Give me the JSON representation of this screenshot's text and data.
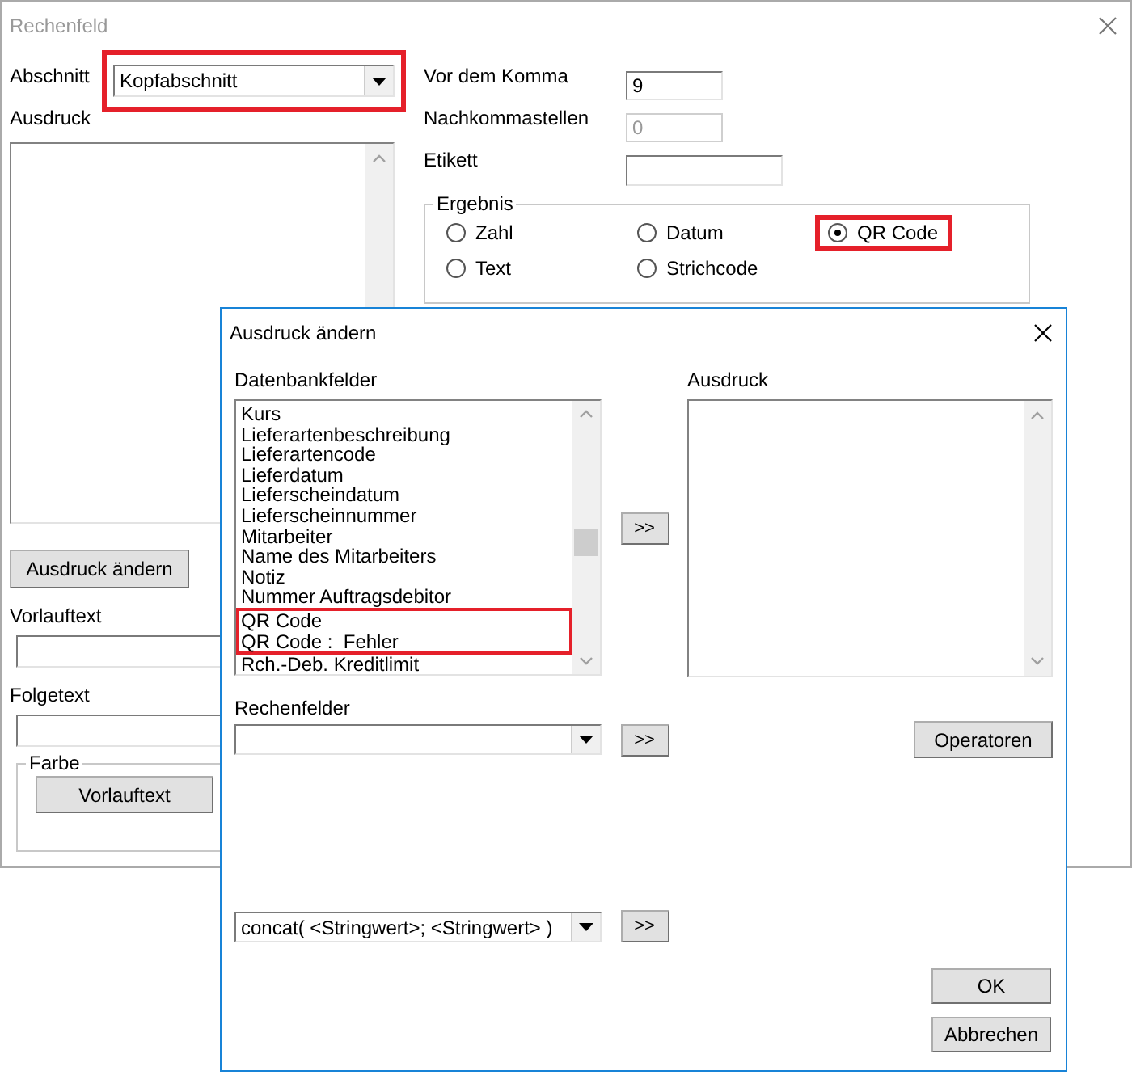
{
  "main_window": {
    "title": "Rechenfeld",
    "active": false,
    "section": {
      "label": "Abschnitt",
      "value": "Kopfabschnitt",
      "highlighted": true
    },
    "expression": {
      "label": "Ausdruck"
    },
    "edit_button": "Ausdruck ändern",
    "prefix": {
      "label": "Vorlauftext"
    },
    "suffix": {
      "label": "Folgetext"
    },
    "color_group": {
      "title": "Farbe",
      "button": "Vorlauftext"
    },
    "fields": [
      {
        "label": "Vor dem Komma",
        "value": "9",
        "disabled": false
      },
      {
        "label": "Nachkommastellen",
        "value": "0",
        "disabled": true
      },
      {
        "label": "Etikett",
        "disabled": false
      }
    ],
    "result_group": {
      "title": "Ergebnis",
      "options": [
        {
          "label": "Zahl",
          "selected": false,
          "highlighted": false
        },
        {
          "label": "Datum",
          "selected": false,
          "highlighted": false
        },
        {
          "label": "QR Code",
          "selected": true,
          "highlighted": true
        },
        {
          "label": "Text",
          "selected": false,
          "highlighted": false
        },
        {
          "label": "Strichcode",
          "selected": false,
          "highlighted": false
        }
      ]
    }
  },
  "dialog": {
    "title": "Ausdruck ändern",
    "active": true,
    "db_fields": {
      "label": "Datenbankfelder",
      "add_button": ">>",
      "items": [
        {
          "label": "Kurs",
          "highlighted": false
        },
        {
          "label": "Lieferartenbeschreibung",
          "highlighted": false
        },
        {
          "label": "Lieferartencode",
          "highlighted": false
        },
        {
          "label": "Lieferdatum",
          "highlighted": false
        },
        {
          "label": "Lieferscheindatum",
          "highlighted": false
        },
        {
          "label": "Lieferscheinnummer",
          "highlighted": false
        },
        {
          "label": "Mitarbeiter",
          "highlighted": false
        },
        {
          "label": "Name des Mitarbeiters",
          "highlighted": false
        },
        {
          "label": "Notiz",
          "highlighted": false
        },
        {
          "label": "Nummer Auftragsdebitor",
          "highlighted": false
        },
        {
          "label": "QR Code",
          "highlighted": true
        },
        {
          "label": "QR Code :  Fehler",
          "highlighted": true
        },
        {
          "label": "Rch.-Deb. Kreditlimit",
          "highlighted": false
        }
      ]
    },
    "expression": {
      "label": "Ausdruck"
    },
    "calc_fields": {
      "label": "Rechenfelder",
      "add_button": ">>"
    },
    "operators_button": "Operatoren",
    "function": {
      "value": "concat( <Stringwert>; <Stringwert> )",
      "add_button": ">>"
    },
    "buttons": [
      "OK",
      "Abbrechen"
    ]
  }
}
